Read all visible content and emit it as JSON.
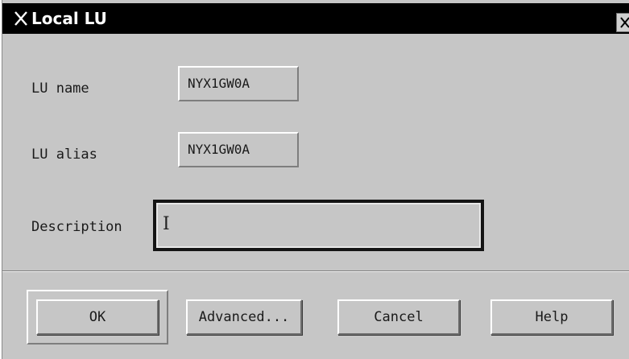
{
  "window": {
    "title": "Local LU",
    "close_icon": "close-icon",
    "menu_icon": "x-window-icon"
  },
  "form": {
    "lu_name": {
      "label": "LU name",
      "value": "NYX1GW0A"
    },
    "lu_alias": {
      "label": "LU alias",
      "value": "NYX1GW0A"
    },
    "description": {
      "label": "Description",
      "value": ""
    }
  },
  "buttons": {
    "ok": "OK",
    "advanced": "Advanced...",
    "cancel": "Cancel",
    "help": "Help"
  }
}
